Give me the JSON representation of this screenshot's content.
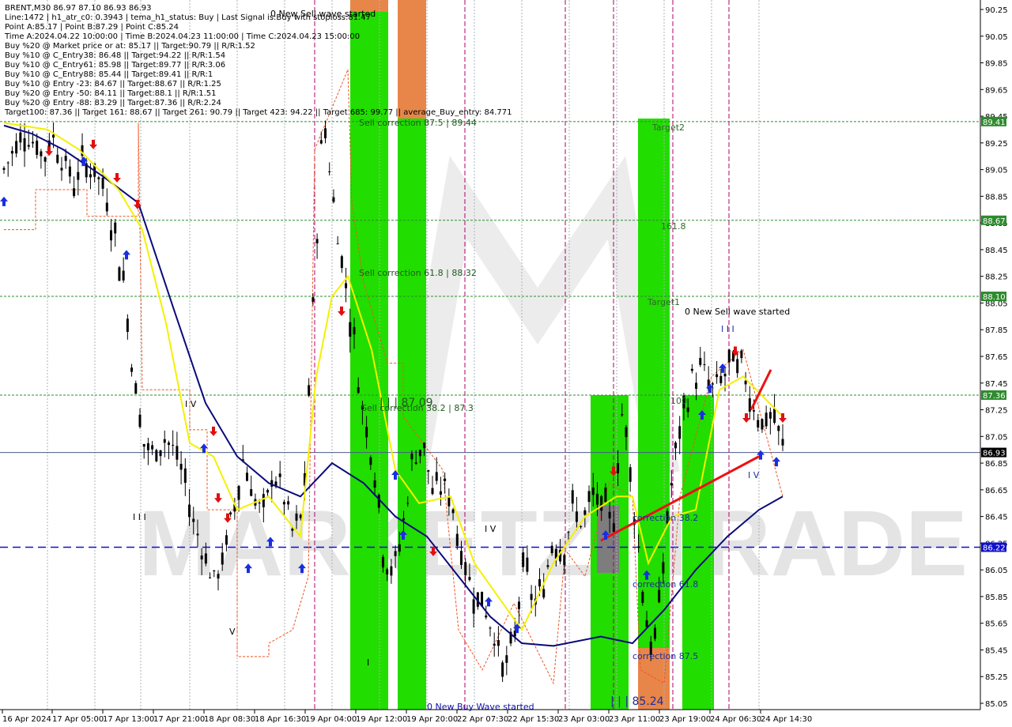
{
  "header": {
    "symbol_line": "BRENT,M30  86.97 87.10 86.93 86.93",
    "info_lines": [
      "Line:1472 | h1_atr_c0: 0.3943 | tema_h1_status: Buy | Last Signal is:Buy with stoploss:81.47",
      "Point A:85.17 | Point B:87.29 | Point C:85.24",
      "Time A:2024.04.22 10:00:00 | Time B:2024.04.23 11:00:00 | Time C:2024.04.23 15:00:00",
      "Buy %20 @ Market price or at: 85.17 || Target:90.79 || R/R:1.52",
      "Buy %10 @ C_Entry38: 86.48 || Target:94.22 || R/R:1.54",
      "Buy %10 @ C_Entry61: 85.98 || Target:89.77 || R/R:3.06",
      "Buy %10 @ C_Entry88: 85.44 || Target:89.41 || R/R:1",
      "Buy %10 @ Entry -23: 84.67 || Target:88.67 || R/R:1.25",
      "Buy %20 @ Entry -50: 84.11 || Target:88.1 || R/R:1.51",
      "Buy %20 @ Entry -88: 83.29 || Target:87.36 || R/R:2.24",
      "Target100: 87.36 || Target 161: 88.67 || Target 261: 90.79 || Target 423: 94.22 || Target 685: 99.77 || average_Buy_entry: 84.771"
    ]
  },
  "price_axis": {
    "ticks": [
      "90.25",
      "90.05",
      "89.85",
      "89.65",
      "89.45",
      "89.25",
      "89.05",
      "88.85",
      "88.65",
      "88.45",
      "88.25",
      "88.05",
      "87.85",
      "87.65",
      "87.45",
      "87.25",
      "87.05",
      "86.85",
      "86.65",
      "86.45",
      "86.25",
      "86.05",
      "85.85",
      "85.65",
      "85.45",
      "85.25",
      "85.05"
    ],
    "tick_values": [
      90.25,
      90.05,
      89.85,
      89.65,
      89.45,
      89.25,
      89.05,
      88.85,
      88.65,
      88.45,
      88.25,
      88.05,
      87.85,
      87.65,
      87.45,
      87.25,
      87.05,
      86.85,
      86.65,
      86.45,
      86.25,
      86.05,
      85.85,
      85.65,
      85.45,
      85.25,
      85.05
    ],
    "badges": [
      {
        "text": "89.41",
        "value": 89.41,
        "color": "#2e8b2e"
      },
      {
        "text": "88.67",
        "value": 88.67,
        "color": "#2e8b2e"
      },
      {
        "text": "88.10",
        "value": 88.1,
        "color": "#2e8b2e"
      },
      {
        "text": "87.36",
        "value": 87.36,
        "color": "#2e8b2e"
      },
      {
        "text": "86.93",
        "value": 86.93,
        "color": "#000000"
      },
      {
        "text": "86.22",
        "value": 86.22,
        "color": "#1010cc"
      }
    ]
  },
  "time_axis": {
    "labels": [
      "16 Apr 2024",
      "17 Apr 05:00",
      "17 Apr 13:00",
      "17 Apr 21:00",
      "18 Apr 08:30",
      "18 Apr 16:30",
      "19 Apr 04:00",
      "19 Apr 12:00",
      "19 Apr 20:00",
      "22 Apr 07:30",
      "22 Apr 15:30",
      "23 Apr 03:00",
      "23 Apr 11:00",
      "23 Apr 19:00",
      "24 Apr 06:30",
      "24 Apr 14:30"
    ]
  },
  "annotations": {
    "top_wave": "0 New Sell wave started",
    "bottom_wave": "0 New Buy Wave started",
    "right_wave": "0 New Sell wave started",
    "sell_corr_875": "Sell correction 87.5 | 89.44",
    "sell_corr_618": "Sell correction 61.8 | 88.32",
    "sell_corr_382": "Sell correction 38.2 | 87.3",
    "level_8709": "| | | 87.09",
    "level_8524": "| | | 85.24",
    "target2": "Target2",
    "target1": "Target1",
    "fib_1618": "161.8",
    "fib_100": "100",
    "corr_382": "correction 38.2",
    "corr_618": "correction 61.8",
    "corr_875": "correction 87.5",
    "wave_iv_1": "I V",
    "wave_iii_1": "I I I",
    "wave_v_1": "V",
    "wave_iv_2": "I V",
    "wave_i_1": "I",
    "wave_iii_2": "I I I",
    "wave_iv_3": "I V"
  },
  "levels": {
    "target_lines": [
      89.41,
      88.67,
      88.1,
      87.36
    ],
    "current_price": 86.93,
    "avg_entry": 86.22
  },
  "colors": {
    "green_zone": "#22dd00",
    "orange_zone": "#e8864a",
    "target_line": "#2e8b2e",
    "current_line": "#4a5a8a",
    "avg_line": "#1010cc",
    "magenta_vline": "#b0006a",
    "gray_vline": "#a8b4b4",
    "yellow_ma": "#f5f000",
    "navy_ma": "#0a0a7a",
    "red_trend": "#ee1111",
    "orange_step": "#ee5522",
    "up_arrow": "#1a2ee0",
    "down_arrow": "#e01010"
  },
  "chart_data": {
    "type": "candlestick",
    "symbol": "BRENT",
    "timeframe": "M30",
    "ylim": [
      85.0,
      90.3
    ],
    "x": [
      "16 Apr 2024",
      "17 Apr 05:00",
      "17 Apr 13:00",
      "17 Apr 21:00",
      "18 Apr 08:30",
      "18 Apr 16:30",
      "19 Apr 04:00",
      "19 Apr 12:00",
      "19 Apr 20:00",
      "22 Apr 07:30",
      "22 Apr 15:30",
      "23 Apr 03:00",
      "23 Apr 11:00",
      "23 Apr 19:00",
      "24 Apr 06:30",
      "24 Apr 14:30"
    ],
    "close_path": [
      89.05,
      89.2,
      89.35,
      89.25,
      89.15,
      89.3,
      89.1,
      88.95,
      89.1,
      89.05,
      88.9,
      88.6,
      88.2,
      87.5,
      87.0,
      86.9,
      87.05,
      86.95,
      86.75,
      86.4,
      86.2,
      85.95,
      86.15,
      86.5,
      86.9,
      86.6,
      86.45,
      86.8,
      86.6,
      86.3,
      86.5,
      88.1,
      89.5,
      88.8,
      88.3,
      87.8,
      87.2,
      86.9,
      86.2,
      86.0,
      86.4,
      86.9,
      87.0,
      86.6,
      86.7,
      86.5,
      86.1,
      85.9,
      85.8,
      85.6,
      85.3,
      85.45,
      86.1,
      85.8,
      85.9,
      86.3,
      86.2,
      86.5,
      86.4,
      86.6,
      86.5,
      86.4,
      87.3,
      86.6,
      85.9,
      85.35,
      86.1,
      86.8,
      87.2,
      87.5,
      87.55,
      87.4,
      87.5,
      87.6,
      87.55,
      87.3,
      87.15,
      87.2,
      86.95
    ],
    "target_levels": {
      "Target100": 87.36,
      "Target161": 88.67,
      "Target261": 90.79
    },
    "point_a": 85.17,
    "point_b": 87.29,
    "point_c": 85.24
  }
}
